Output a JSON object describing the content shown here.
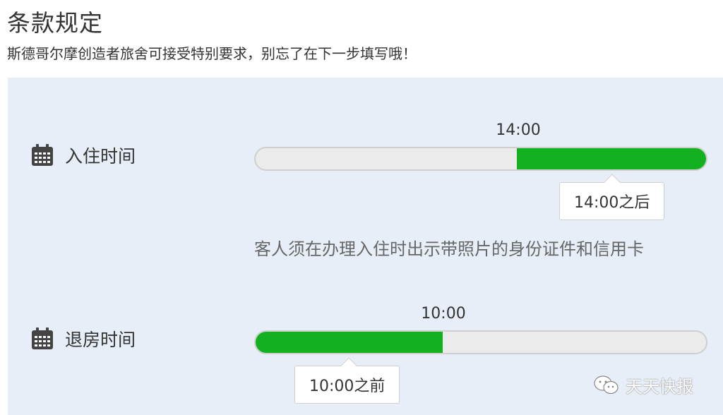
{
  "header": {
    "title": "条款规定",
    "subtitle": "斯德哥尔摩创造者旅舍可接受特别要求，别忘了在下一步填写哦！"
  },
  "checkin": {
    "icon": "calendar-icon",
    "label": "入住时间",
    "time": "14:00",
    "tooltip": "14:00之后",
    "bar_fill_start_fraction": 0.58,
    "bar_fill_end_fraction": 1.0,
    "note": "客人须在办理入住时出示带照片的身份证件和信用卡"
  },
  "checkout": {
    "icon": "calendar-icon",
    "label": "退房时间",
    "time": "10:00",
    "tooltip": "10:00之前",
    "bar_fill_start_fraction": 0.0,
    "bar_fill_end_fraction": 0.415
  },
  "watermark": {
    "icon": "wechat-icon",
    "text": "天天快报"
  },
  "colors": {
    "accent": "#13b01f",
    "panel_bg": "#e8eef8",
    "bar_bg": "#ebebeb"
  }
}
